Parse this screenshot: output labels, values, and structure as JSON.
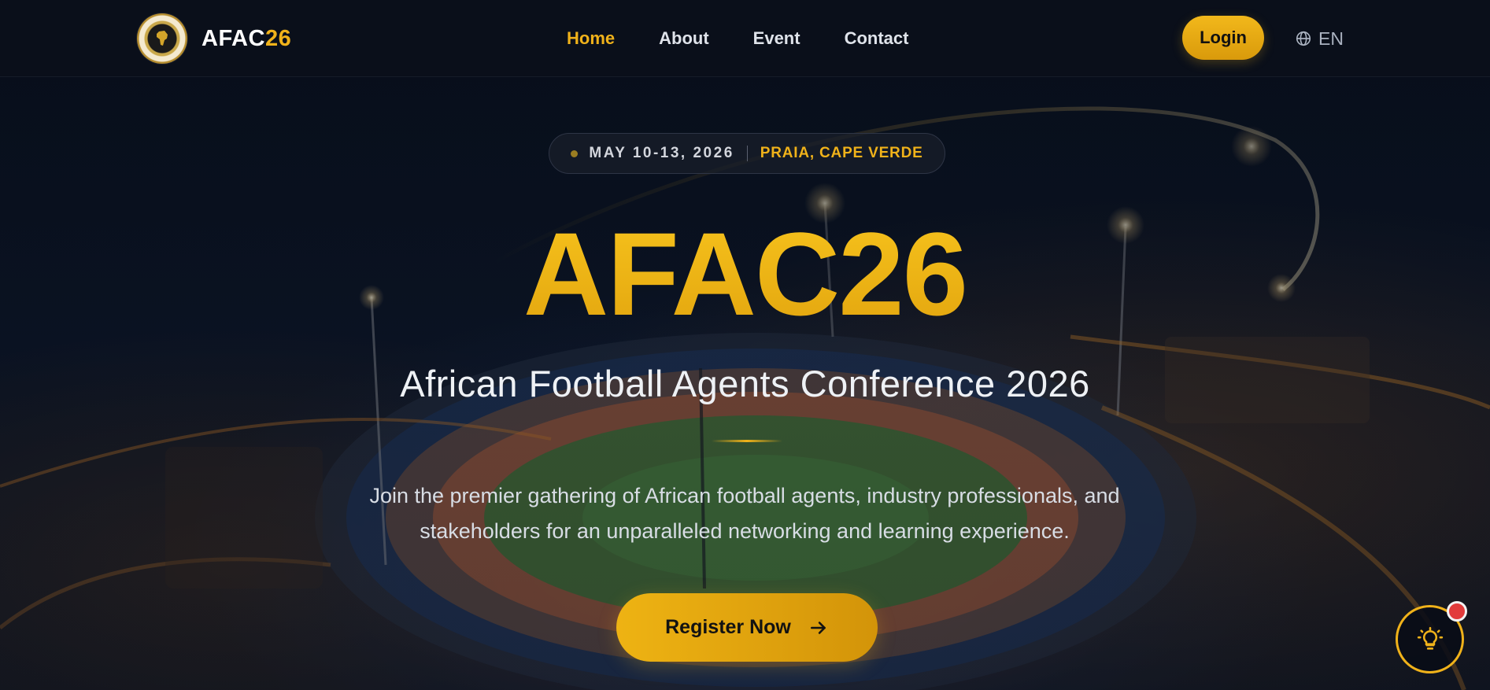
{
  "brand": {
    "name_main": "AFAC",
    "name_accent": "26"
  },
  "nav": {
    "items": [
      {
        "label": "Home",
        "active": true
      },
      {
        "label": "About",
        "active": false
      },
      {
        "label": "Event",
        "active": false
      },
      {
        "label": "Contact",
        "active": false
      }
    ]
  },
  "header": {
    "login_label": "Login",
    "language": "EN"
  },
  "hero": {
    "date": "MAY 10-13, 2026",
    "location": "PRAIA, CAPE VERDE",
    "title": "AFAC26",
    "subtitle": "African Football Agents Conference 2026",
    "description_line1": "Join the premier gathering of African football agents, industry professionals, and",
    "description_line2": "stakeholders for an unparalleled networking and learning experience.",
    "cta_label": "Register Now"
  },
  "icons": {
    "logo": "afac-crest-logo",
    "language": "globe-icon",
    "cta": "arrow-right-icon",
    "fab": "lightbulb-icon"
  },
  "colors": {
    "accent": "#f0b21a",
    "background": "#0a0f1a",
    "badge": "#e23b3b"
  }
}
